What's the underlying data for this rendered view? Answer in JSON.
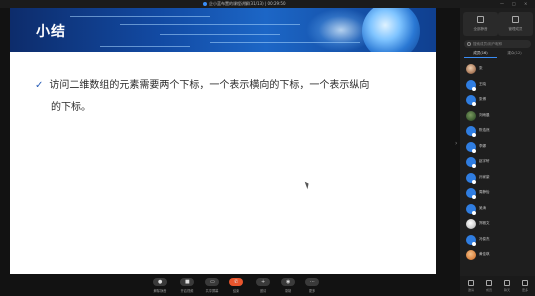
{
  "titlebar": {
    "title": "企小蓝布置的课程讲解(31/13)  | 00:29:50",
    "controls": [
      "—",
      "□",
      "×"
    ]
  },
  "slide": {
    "title": "小结",
    "lines": [
      "访问二维数组的元素需要两个下标，一个表示横向的下标，一个表示纵向",
      "的下标。"
    ],
    "check_glyph": "✓"
  },
  "panel": {
    "top_buttons": [
      {
        "label": "全部静音",
        "icon": "mute-all-icon"
      },
      {
        "label": "管理成员",
        "icon": "manage-icon"
      }
    ],
    "search_placeholder": "搜索成员/用户昵称",
    "tabs": [
      {
        "label": "成员(16)",
        "active": true
      },
      {
        "label": "观众(12)",
        "active": false
      }
    ],
    "participants": [
      {
        "name": "张",
        "avatar": "photo"
      },
      {
        "name": "王晓",
        "avatar": "blue"
      },
      {
        "name": "张博",
        "avatar": "blue"
      },
      {
        "name": "刘雨晨",
        "avatar": "photo2"
      },
      {
        "name": "陈浩然",
        "avatar": "blue"
      },
      {
        "name": "李娜",
        "avatar": "blue"
      },
      {
        "name": "赵宇轩",
        "avatar": "blue"
      },
      {
        "name": "孙家豪",
        "avatar": "blue"
      },
      {
        "name": "周静怡",
        "avatar": "blue"
      },
      {
        "name": "吴涛",
        "avatar": "blue"
      },
      {
        "name": "郑雅文",
        "avatar": "photo3"
      },
      {
        "name": "冯俊杰",
        "avatar": "blue"
      },
      {
        "name": "黄佳琪",
        "avatar": "photo4"
      }
    ],
    "bottom_tools": [
      "邀请",
      "成员",
      "聊天",
      "更多"
    ]
  },
  "toolbar": {
    "buttons": [
      {
        "label": "解除静音",
        "glyph": "●"
      },
      {
        "label": "开启视频",
        "glyph": "■"
      },
      {
        "label": "共享屏幕",
        "glyph": "▭"
      },
      {
        "label": "结束",
        "glyph": "✆",
        "accent": true
      },
      {
        "label": "邀请",
        "glyph": "+"
      },
      {
        "label": "录制",
        "glyph": "◉"
      },
      {
        "label": "更多",
        "glyph": "···"
      }
    ]
  },
  "colors": {
    "accent": "#3a8df5",
    "end_button": "#e8552d",
    "slide_title_text": "#ffffff",
    "check": "#2b5fb8"
  }
}
